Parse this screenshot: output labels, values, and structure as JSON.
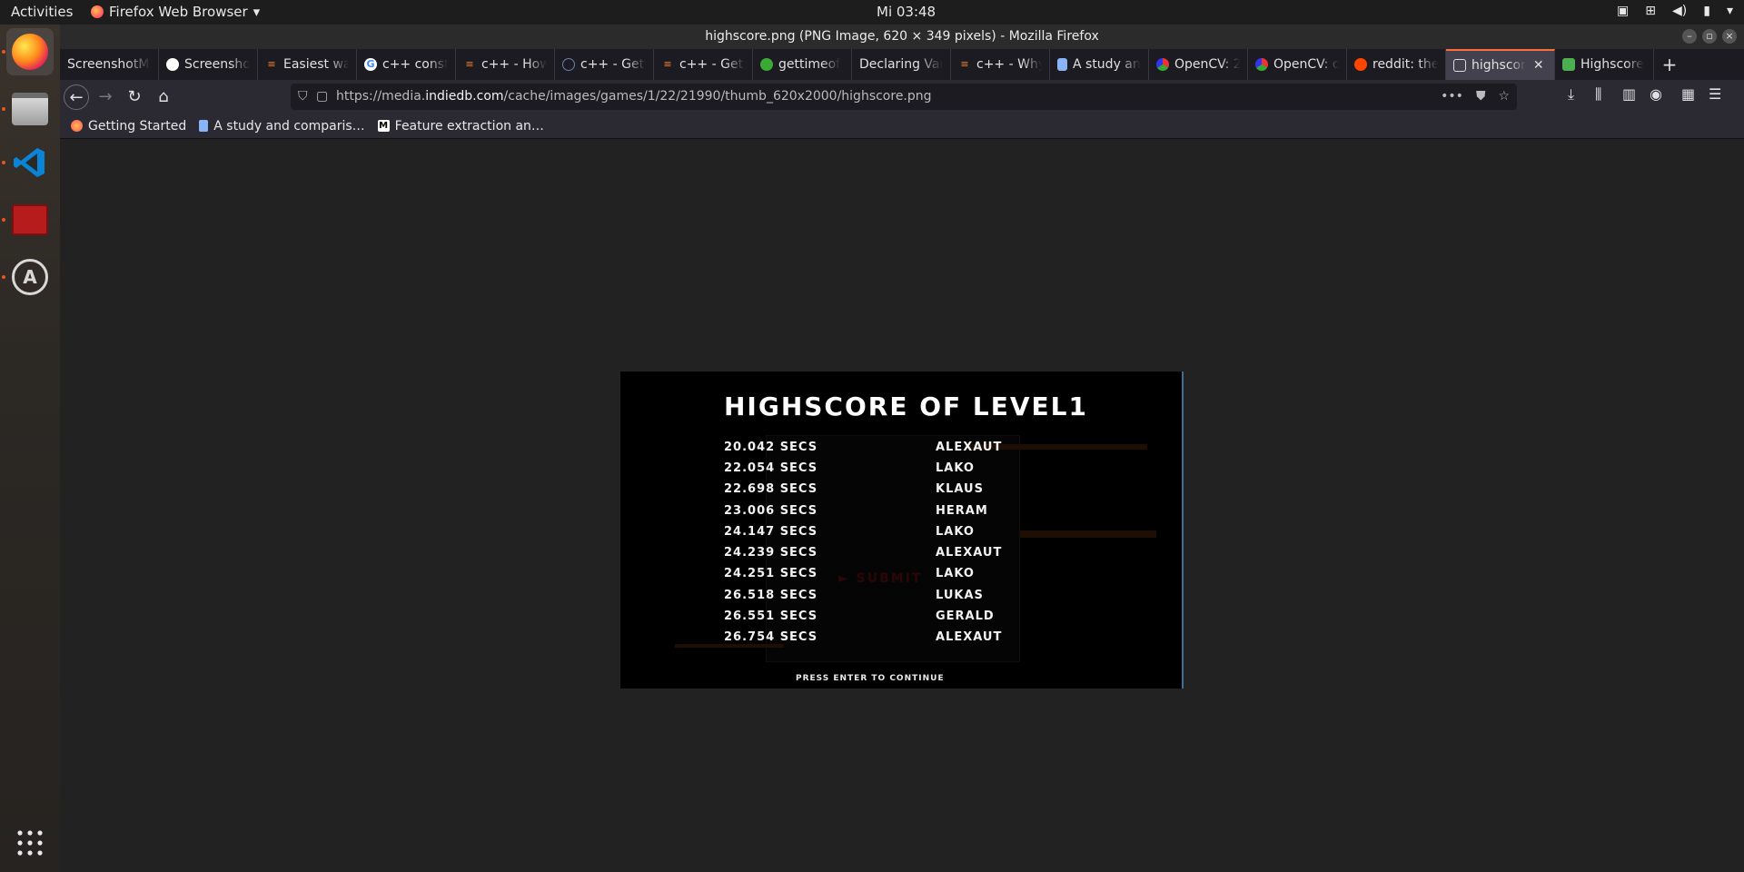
{
  "topbar": {
    "activities": "Activities",
    "app_menu": "Firefox Web Browser",
    "clock": "Mi 03:48"
  },
  "window": {
    "title": "highscore.png (PNG Image, 620 × 349 pixels) - Mozilla Firefox"
  },
  "tabs": [
    {
      "label": "ScreenshotMa",
      "icon": "page-icon",
      "color": "#cccccc"
    },
    {
      "label": "Screensho",
      "icon": "github-icon",
      "color": "#ffffff"
    },
    {
      "label": "Easiest wa",
      "icon": "stackoverflow-icon",
      "color": "#f48024"
    },
    {
      "label": "c++ const",
      "icon": "google-icon",
      "color": "#4285f4"
    },
    {
      "label": "c++ - How",
      "icon": "stackoverflow-icon",
      "color": "#f48024"
    },
    {
      "label": "c++ - Getti",
      "icon": "globe-icon",
      "color": "#6b7fa8"
    },
    {
      "label": "c++ - Get m",
      "icon": "stackoverflow-icon",
      "color": "#f48024"
    },
    {
      "label": "gettimeof",
      "icon": "bug-icon",
      "color": "#3aaa35"
    },
    {
      "label": "Declaring Var",
      "icon": "",
      "color": "#cccccc"
    },
    {
      "label": "c++ - Why c",
      "icon": "stackoverflow-icon",
      "color": "#f48024"
    },
    {
      "label": "A study an",
      "icon": "document-icon",
      "color": "#8ab4f8"
    },
    {
      "label": "OpenCV: 2",
      "icon": "opencv-icon",
      "color": "#e33"
    },
    {
      "label": "OpenCV: c",
      "icon": "opencv-icon",
      "color": "#e33"
    },
    {
      "label": "reddit: the",
      "icon": "reddit-icon",
      "color": "#ff4500"
    },
    {
      "label": "highscor",
      "icon": "image-icon",
      "color": "#dddddd",
      "selected": true
    },
    {
      "label": "Highscore",
      "icon": "indiedb-icon",
      "color": "#4caf50"
    }
  ],
  "navbar": {
    "url_prefix": "https://media.",
    "url_host": "indiedb.com",
    "url_path": "/cache/images/games/1/22/21990/thumb_620x2000/highscore.png"
  },
  "bookmarks": [
    {
      "label": "Getting Started",
      "color": "#ff7139"
    },
    {
      "label": "A study and comparis…",
      "color": "#8ab4f8"
    },
    {
      "label": "Feature extraction an…",
      "color": "#ffffff"
    }
  ],
  "game": {
    "title": "HIGHSCORE OF LEVEL1",
    "scores": [
      {
        "time": "20.042  SECS",
        "name": "ALEXAUT"
      },
      {
        "time": "22.054  SECS",
        "name": "LAKO"
      },
      {
        "time": "22.698  SECS",
        "name": "KLAUS"
      },
      {
        "time": "23.006  SECS",
        "name": "HERAM"
      },
      {
        "time": "24.147  SECS",
        "name": "LAKO"
      },
      {
        "time": "24.239  SECS",
        "name": "ALEXAUT"
      },
      {
        "time": "24.251  SECS",
        "name": "LAKO"
      },
      {
        "time": "26.518  SECS",
        "name": "LUKAS"
      },
      {
        "time": "26.551  SECS",
        "name": "GERALD"
      },
      {
        "time": "26.754  SECS",
        "name": "ALEXAUT"
      }
    ],
    "footer": "PRESS ENTER TO CONTINUE"
  }
}
